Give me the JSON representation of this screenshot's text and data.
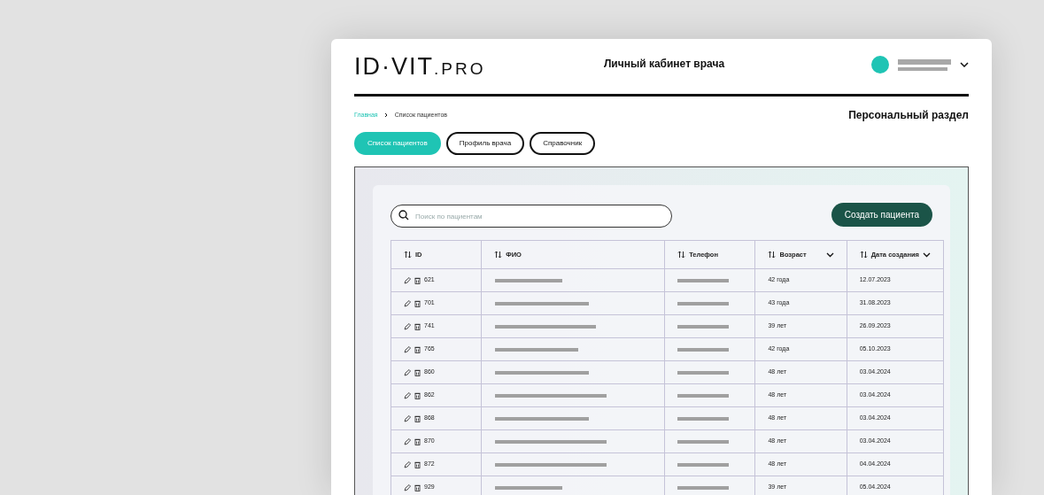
{
  "header": {
    "logo": {
      "main": "ID·VIT",
      "suffix": ".PRO"
    },
    "title": "Личный кабинет врача"
  },
  "breadcrumbs": [
    {
      "label": "Главная",
      "current": false
    },
    {
      "label": "Список пациентов",
      "current": true
    }
  ],
  "section_title": "Персональный раздел",
  "tabs": [
    {
      "label": "Список пациентов",
      "selected": true
    },
    {
      "label": "Профиль врача",
      "selected": false
    },
    {
      "label": "Справочник",
      "selected": false
    }
  ],
  "search": {
    "placeholder": "Поиск по пациентам"
  },
  "create_button": "Создать пациента",
  "table": {
    "columns": [
      {
        "label": "ID",
        "dropdown": false
      },
      {
        "label": "ФИО",
        "dropdown": false
      },
      {
        "label": "Телефон",
        "dropdown": false
      },
      {
        "label": "Возраст",
        "dropdown": true
      },
      {
        "label": "Дата создания",
        "dropdown": true
      }
    ],
    "rows": [
      {
        "id": "621",
        "age": "42 года",
        "created": "12.07.2023"
      },
      {
        "id": "701",
        "age": "43 года",
        "created": "31.08.2023"
      },
      {
        "id": "741",
        "age": "39 лет",
        "created": "26.09.2023"
      },
      {
        "id": "765",
        "age": "42 года",
        "created": "05.10.2023"
      },
      {
        "id": "860",
        "age": "48 лет",
        "created": "03.04.2024"
      },
      {
        "id": "862",
        "age": "48 лет",
        "created": "03.04.2024"
      },
      {
        "id": "868",
        "age": "48 лет",
        "created": "03.04.2024"
      },
      {
        "id": "870",
        "age": "48 лет",
        "created": "03.04.2024"
      },
      {
        "id": "872",
        "age": "48 лет",
        "created": "04.04.2024"
      },
      {
        "id": "929",
        "age": "39 лет",
        "created": "05.04.2024"
      }
    ]
  }
}
